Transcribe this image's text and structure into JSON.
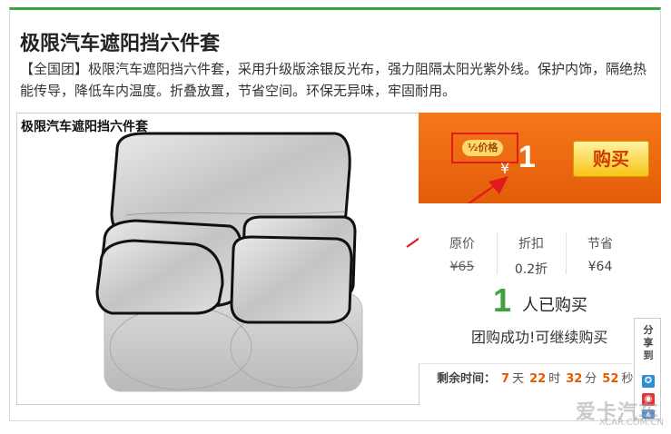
{
  "product": {
    "title": "极限汽车遮阳挡六件套",
    "description": "【全国团】极限汽车遮阳挡六件套，采用升级版涂银反光布，强力阻隔太阳光紫外线。保护内饰，隔绝热能传导，降低车内温度。折叠放置，节省空间。环保无异味，牢固耐用。",
    "image_caption": "极限汽车遮阳挡六件套"
  },
  "deal": {
    "badge_label": "½价格",
    "currency": "¥",
    "price": "1",
    "buy_label": "购买"
  },
  "stats": {
    "original_label": "原价",
    "original_value": "¥65",
    "discount_label": "折扣",
    "discount_value": "0.2折",
    "saving_label": "节省",
    "saving_value": "¥64"
  },
  "purchase": {
    "count": "1",
    "count_suffix": "人已购买",
    "success_message": "团购成功!可继续购买"
  },
  "timer": {
    "label": "剩余时间：",
    "days": "7",
    "days_unit": "天",
    "hours": "22",
    "hours_unit": "时",
    "minutes": "32",
    "minutes_unit": "分",
    "seconds": "52",
    "seconds_unit": "秒"
  },
  "share": {
    "label": "分享到"
  },
  "watermark": {
    "text": "爱卡汽车",
    "sub": "XCAR.COM.CN"
  },
  "colors": {
    "accent_green": "#3aa53a",
    "price_orange": "#f06a10",
    "buy_yellow": "#f7c417",
    "badge_red": "#e01b1b"
  }
}
